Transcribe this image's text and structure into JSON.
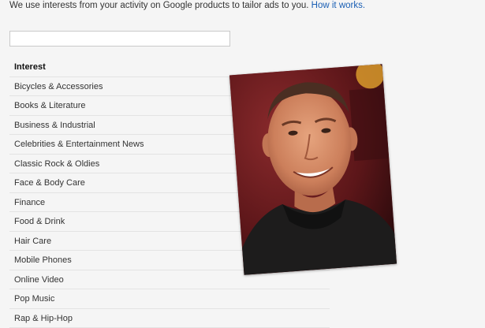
{
  "intro": {
    "text": "We use interests from your activity on Google products to tailor ads to you.",
    "link": "How it works."
  },
  "search": {
    "value": "",
    "placeholder": ""
  },
  "interests": {
    "header": "Interest",
    "items": [
      "Bicycles & Accessories",
      "Books & Literature",
      "Business & Industrial",
      "Celebrities & Entertainment News",
      "Classic Rock & Oldies",
      "Face & Body Care",
      "Finance",
      "Food & Drink",
      "Hair Care",
      "Mobile Phones",
      "Online Video",
      "Pop Music",
      "Rap & Hip-Hop"
    ]
  },
  "photo": {
    "subject": "portrait-photo"
  },
  "colors": {
    "link": "#1a5fb4",
    "background": "#f5f5f5",
    "divider": "#e3e3e3"
  }
}
